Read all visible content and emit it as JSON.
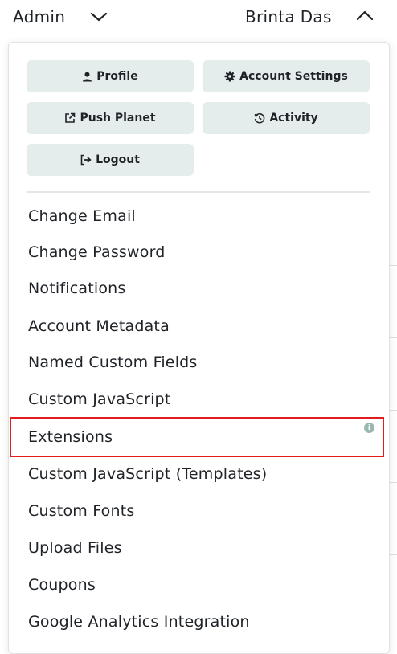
{
  "topbar": {
    "admin_label": "Admin",
    "user_name": "Brinta Das"
  },
  "quick_actions": {
    "profile": "Profile",
    "account_settings": "Account Settings",
    "push_planet": "Push Planet",
    "activity": "Activity",
    "logout": "Logout"
  },
  "menu": {
    "items": [
      "Change Email",
      "Change Password",
      "Notifications",
      "Account Metadata",
      "Named Custom Fields",
      "Custom JavaScript",
      "Extensions",
      "Custom JavaScript (Templates)",
      "Custom Fonts",
      "Upload Files",
      "Coupons",
      "Google Analytics Integration"
    ],
    "highlighted": "Extensions",
    "info_badge": "i"
  },
  "colors": {
    "button_bg": "#e4ecec",
    "highlight_border": "#e11d1d",
    "info_badge": "#9bb7b2"
  },
  "icons": [
    "chevron-down-icon",
    "chevron-up-icon",
    "user-icon",
    "gear-icon",
    "external-link-icon",
    "history-icon",
    "logout-icon",
    "info-icon"
  ]
}
